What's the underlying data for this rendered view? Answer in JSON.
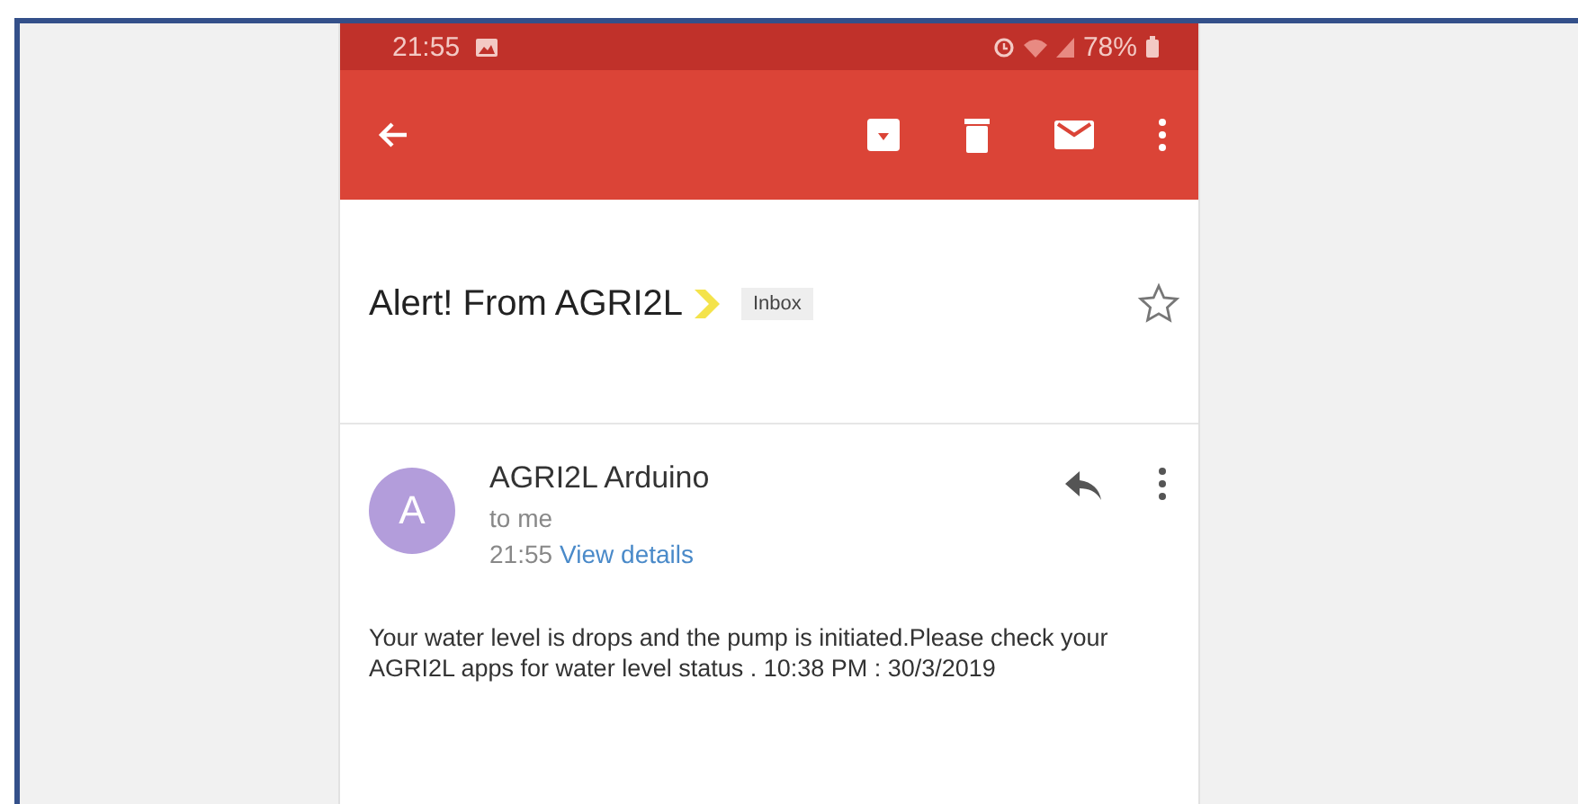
{
  "status_bar": {
    "time": "21:55",
    "battery": "78%"
  },
  "email": {
    "subject": "Alert! From AGRI2L",
    "important": true,
    "label": "Inbox",
    "starred": false,
    "sender": {
      "initial": "A",
      "name": "AGRI2L Arduino",
      "color": "#b39ddb"
    },
    "recipient": "to me",
    "time": "21:55",
    "details_link": "View details",
    "body": "Your water level is drops and the pump is initiated.Please check your AGRI2L apps for water level status . 10:38 PM : 30/3/2019"
  }
}
